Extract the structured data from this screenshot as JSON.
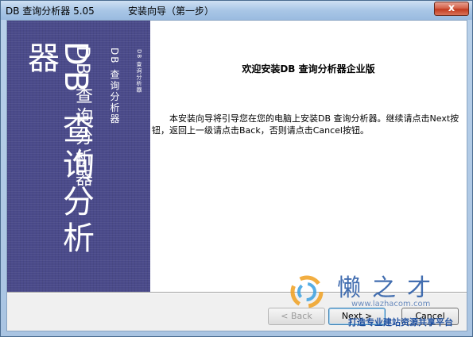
{
  "window": {
    "app_title": "DB 查询分析器 5.05",
    "step_title": "安装向导（第一步）",
    "close_label": "x"
  },
  "side_banner": {
    "large_text": "DB 查询分析器",
    "medium_text": "DB 查询分析器",
    "small_text": "DB 查询分析器",
    "tiny_text": "DB 查询分析器"
  },
  "content": {
    "heading": "欢迎安装DB 查询分析器企业版",
    "body": "本安装向导将引导您在您的电脑上安装DB 查询分析器。继续请点击Next按钮，返回上一级请点击Back，否则请点击Cancel按钮。"
  },
  "buttons": {
    "back_label": "< Back",
    "next_label": "Next >",
    "cancel_label": "Cancel"
  },
  "watermark": {
    "title": "懒之才",
    "domain": "www.lazhacom.com",
    "slogan": "打造专业建站资源共享平台"
  },
  "colors": {
    "banner": "#4a4a8a",
    "watermark": "#2f5fa8"
  }
}
